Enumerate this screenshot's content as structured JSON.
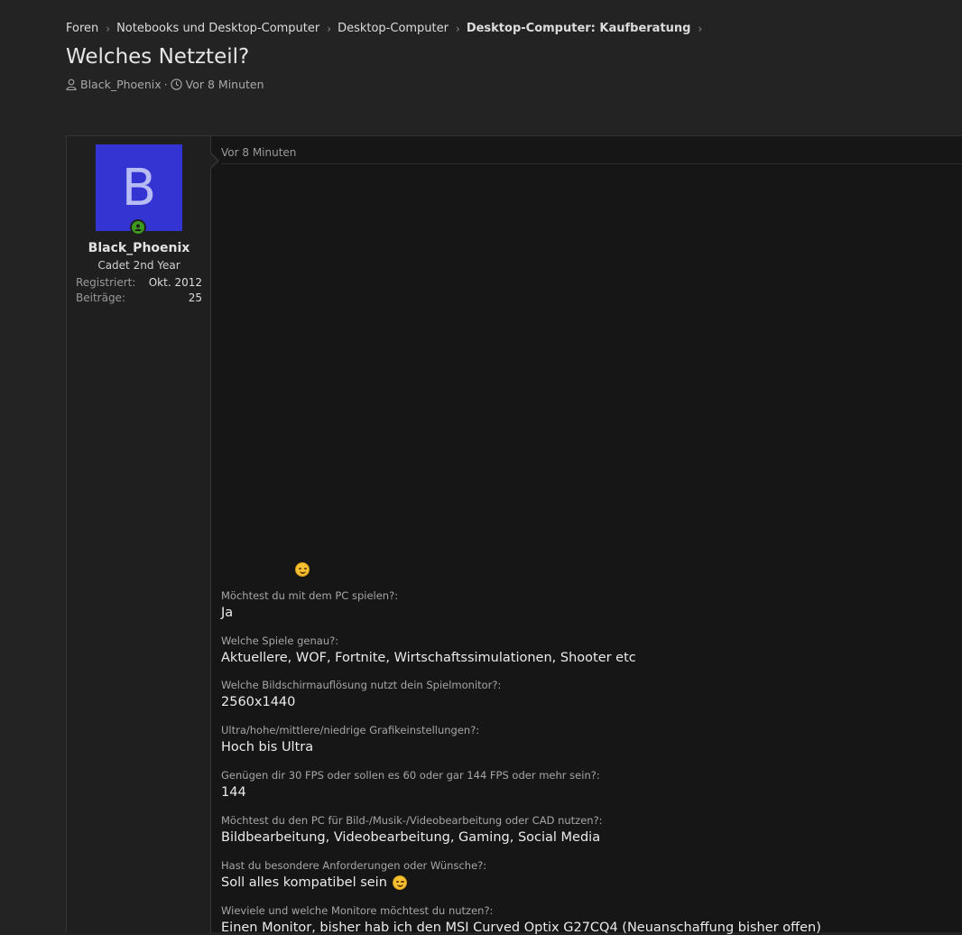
{
  "breadcrumb": {
    "items": [
      "Foren",
      "Notebooks und Desktop-Computer",
      "Desktop-Computer",
      "Desktop-Computer: Kaufberatung"
    ]
  },
  "thread": {
    "title": "Welches Netzteil?",
    "author": "Black_Phoenix",
    "separator": "·",
    "time": "Vor 8 Minuten"
  },
  "user": {
    "avatar_letter": "B",
    "avatar_color": "#3434d2",
    "name": "Black_Phoenix",
    "title": "Cadet 2nd Year",
    "registered_label": "Registriert:",
    "registered_value": "Okt. 2012",
    "posts_label": "Beiträge:",
    "posts_value": "25"
  },
  "post": {
    "time": "Vor 8 Minuten",
    "qa": [
      {
        "q": "Möchtest du mit dem PC spielen?:",
        "a": "Ja"
      },
      {
        "q": "Welche Spiele genau?:",
        "a": "Aktuellere, WOF, Fortnite, Wirtschaftssimulationen, Shooter etc"
      },
      {
        "q": "Welche Bildschirmauflösung nutzt dein Spielmonitor?:",
        "a": "2560x1440"
      },
      {
        "q": "Ultra/hohe/mittlere/niedrige Grafikeinstellungen?:",
        "a": "Hoch bis Ultra"
      },
      {
        "q": "Genügen dir 30 FPS oder sollen es 60 oder gar 144 FPS oder mehr sein?:",
        "a": "144"
      },
      {
        "q": "Möchtest du den PC für Bild-/Musik-/Videobearbeitung oder CAD nutzen?:",
        "a": "Bildbearbeitung, Videobearbeitung, Gaming, Social Media"
      },
      {
        "q": "Hast du besondere Anforderungen oder Wünsche?:",
        "a": "Soll alles kompatibel sein"
      },
      {
        "q": "Wieviele und welche Monitore möchtest du nutzen?:",
        "a": "Einen Monitor, bisher hab ich den MSI Curved Optix G27CQ4 (Neuanschaffung bisher offen)"
      }
    ]
  },
  "icons": {
    "breadcrumb_separator": "chevron-right-icon",
    "author": "user-icon",
    "time": "clock-icon",
    "online": "online-status-icon"
  }
}
